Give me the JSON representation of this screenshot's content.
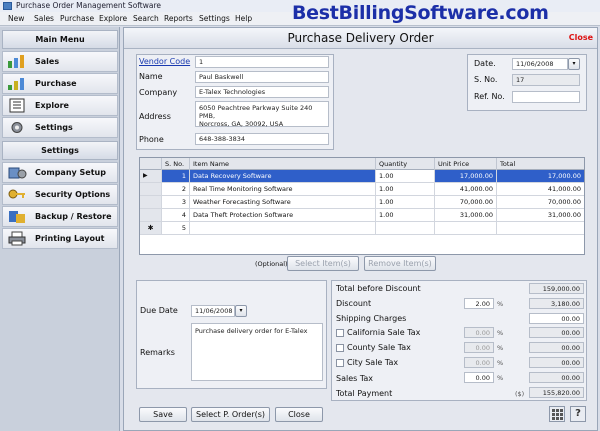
{
  "app": {
    "window_title": "Purchase Order Management Software",
    "brand": "BestBillingSoftware.com"
  },
  "menu": [
    "New",
    "Sales",
    "Purchase",
    "Explore",
    "Search",
    "Reports",
    "Settings",
    "Help"
  ],
  "sidebar": {
    "main_menu_title": "Main Menu",
    "main_items": [
      {
        "label": "Sales",
        "icon": "sales-icon"
      },
      {
        "label": "Purchase",
        "icon": "purchase-icon"
      },
      {
        "label": "Explore",
        "icon": "explore-icon"
      },
      {
        "label": "Settings",
        "icon": "gear-icon"
      }
    ],
    "settings_title": "Settings",
    "settings_items": [
      {
        "label": "Company Setup",
        "icon": "company-setup-icon"
      },
      {
        "label": "Security Options",
        "icon": "key-icon"
      },
      {
        "label": "Backup / Restore",
        "icon": "backup-icon"
      },
      {
        "label": "Printing Layout",
        "icon": "printer-icon"
      }
    ]
  },
  "form": {
    "title": "Purchase Delivery Order",
    "close_label": "Close",
    "vendor_code_label": "Vendor Code",
    "vendor_code": "1",
    "name_label": "Name",
    "name": "Paul Baskwell",
    "company_label": "Company",
    "company": "E-Talex Technologies",
    "address_label": "Address",
    "address_line1": "6050 Peachtree Parkway Suite 240 PMB,",
    "address_line2": "Norcross, GA, 30092, USA",
    "phone_label": "Phone",
    "phone": "648-388-3834",
    "date_label": "Date.",
    "date": "11/06/2008",
    "sno_label": "S. No.",
    "sno": "17",
    "refno_label": "Ref. No.",
    "refno": ""
  },
  "items_table": {
    "columns": [
      "S. No.",
      "Item Name",
      "Quantity",
      "Unit Price",
      "Total"
    ],
    "rows": [
      {
        "sno": "1",
        "item": "Data Recovery Software",
        "qty": "1.00",
        "price": "17,000.00",
        "total": "17,000.00"
      },
      {
        "sno": "2",
        "item": "Real Time Monitoring Software",
        "qty": "1.00",
        "price": "41,000.00",
        "total": "41,000.00"
      },
      {
        "sno": "3",
        "item": "Weather Forecasting Software",
        "qty": "1.00",
        "price": "70,000.00",
        "total": "70,000.00"
      },
      {
        "sno": "4",
        "item": "Data Theft Protection Software",
        "qty": "1.00",
        "price": "31,000.00",
        "total": "31,000.00"
      },
      {
        "sno": "5",
        "item": "",
        "qty": "",
        "price": "",
        "total": ""
      }
    ],
    "optional_label": "(Optional)",
    "select_items_label": "Select Item(s)",
    "remove_items_label": "Remove Item(s)"
  },
  "lower_left": {
    "due_date_label": "Due Date",
    "due_date": "11/06/2008",
    "remarks_label": "Remarks",
    "remarks": "Purchase delivery order for E-Talex"
  },
  "totals": {
    "total_before_discount_label": "Total before Discount",
    "total_before_discount": "159,000.00",
    "discount_label": "Discount",
    "discount_pct": "2.00",
    "discount_value": "3,180.00",
    "shipping_label": "Shipping Charges",
    "shipping": "00.00",
    "california_label": "California Sale Tax",
    "california_pct": "0.00",
    "california_value": "00.00",
    "county_label": "County Sale Tax",
    "county_pct": "0.00",
    "county_value": "00.00",
    "city_label": "City Sale Tax",
    "city_pct": "0.00",
    "city_value": "00.00",
    "sales_tax_label": "Sales Tax",
    "sales_tax_pct": "0.00",
    "sales_tax_value": "00.00",
    "total_payment_label": "Total Payment",
    "currency": "($)",
    "total_payment": "155,820.00",
    "pct_sign": "%"
  },
  "buttons": {
    "save": "Save",
    "select_po": "Select P. Order(s)",
    "close": "Close"
  }
}
